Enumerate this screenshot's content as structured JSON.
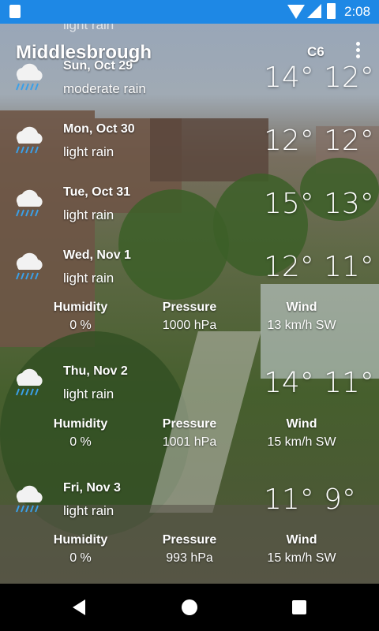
{
  "status_bar": {
    "time": "2:08"
  },
  "header": {
    "city": "Middlesbrough",
    "unit": "C6"
  },
  "partial_top": {
    "desc": "light rain"
  },
  "days": [
    {
      "date": "Sun, Oct 29",
      "desc": "moderate rain",
      "hi": "14°",
      "lo": "12°"
    },
    {
      "date": "Mon, Oct 30",
      "desc": "light rain",
      "hi": "12°",
      "lo": "12°"
    },
    {
      "date": "Tue, Oct 31",
      "desc": "light rain",
      "hi": "15°",
      "lo": "13°"
    },
    {
      "date": "Wed, Nov 1",
      "desc": "light rain",
      "hi": "12°",
      "lo": "11°",
      "details": {
        "humidity_label": "Humidity",
        "humidity": "0 %",
        "pressure_label": "Pressure",
        "pressure": "1000 hPa",
        "wind_label": "Wind",
        "wind": "13 km/h SW"
      }
    },
    {
      "date": "Thu, Nov 2",
      "desc": "light rain",
      "hi": "14°",
      "lo": "11°",
      "details": {
        "humidity_label": "Humidity",
        "humidity": "0 %",
        "pressure_label": "Pressure",
        "pressure": "1001 hPa",
        "wind_label": "Wind",
        "wind": "15 km/h SW"
      }
    },
    {
      "date": "Fri, Nov 3",
      "desc": "light rain",
      "hi": "11°",
      "lo": "9°",
      "details": {
        "humidity_label": "Humidity",
        "humidity": "0 %",
        "pressure_label": "Pressure",
        "pressure": "993 hPa",
        "wind_label": "Wind",
        "wind": "15 km/h SW"
      }
    }
  ],
  "icons": {
    "weather": "rain-cloud-icon",
    "menu": "more-vert-icon"
  },
  "colors": {
    "status_bar": "#1e88e5",
    "rain": "#3aa0e8"
  }
}
